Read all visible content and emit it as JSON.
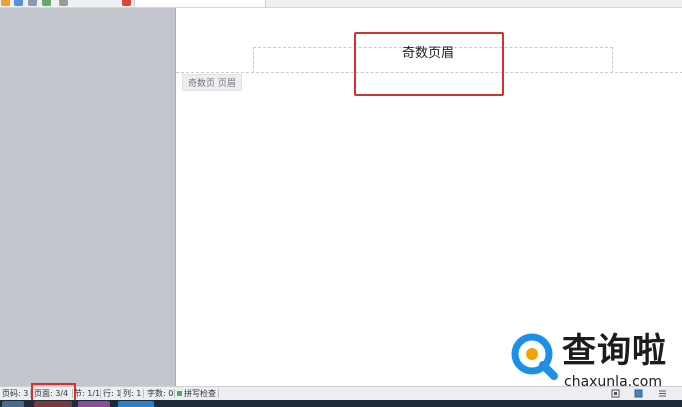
{
  "document": {
    "header_text": "奇数页眉",
    "header_tag": "奇数页 页眉"
  },
  "statusbar": {
    "page_no": "页码: 3",
    "pages": "页面: 3/4",
    "section": "节: 1/1",
    "row": "行: 1",
    "column": "列: 1",
    "word_count": "字数: 0",
    "spell_check": "拼写检查"
  },
  "watermark": {
    "title": "查询啦",
    "domain": "chaxunla.com"
  },
  "icons": {
    "toolbar": [
      "open-icon",
      "save-icon",
      "print-icon",
      "undo-icon",
      "redo-icon",
      "document-icon"
    ],
    "view": [
      "full-screen-icon",
      "page-view-icon",
      "outline-view-icon"
    ],
    "watermark_logo": "search-magnifier-logo"
  },
  "colors": {
    "highlight": "#d6312b",
    "workspace": "#c3c6cc",
    "page": "#ffffff",
    "logo_blue": "#1e8fe8",
    "logo_orange": "#f5a300"
  }
}
